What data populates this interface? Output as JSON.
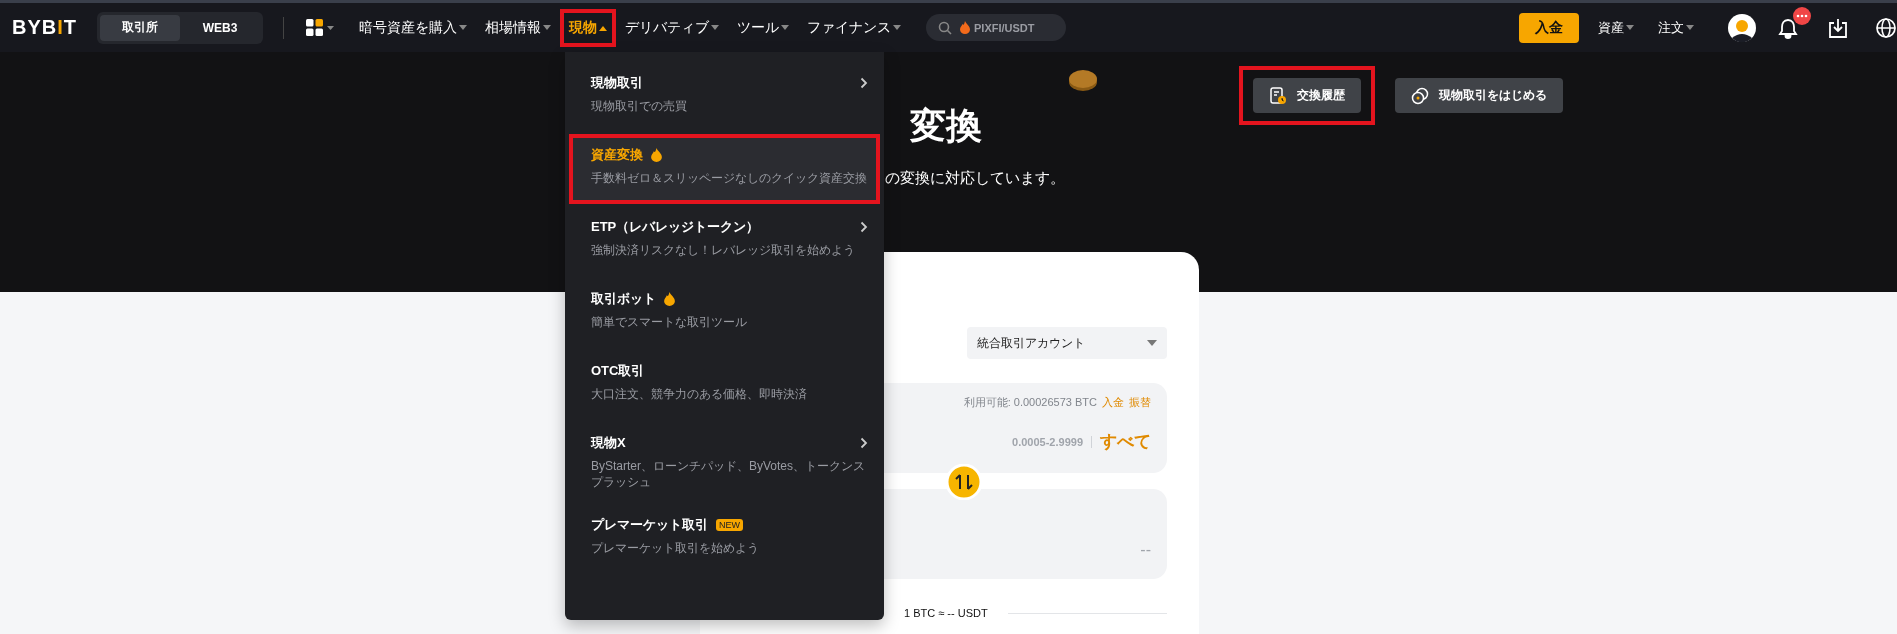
{
  "header": {
    "logo": "BYBIT",
    "segments": [
      {
        "label": "取引所",
        "selected": true
      },
      {
        "label": "WEB3",
        "selected": false
      }
    ],
    "nav": [
      {
        "label": "暗号資産を購入",
        "selected": false,
        "annotated": false
      },
      {
        "label": "相場情報",
        "selected": false,
        "annotated": false
      },
      {
        "label": "現物",
        "selected": true,
        "annotated": true
      },
      {
        "label": "デリバティブ",
        "selected": false,
        "annotated": false
      },
      {
        "label": "ツール",
        "selected": false,
        "annotated": false
      },
      {
        "label": "ファイナンス",
        "selected": false,
        "annotated": false
      }
    ],
    "search": {
      "value": "PIXFI/USDT"
    },
    "deposit_button": "入金",
    "right_menus": [
      "資産",
      "注文"
    ]
  },
  "dropdown": {
    "items": [
      {
        "title": "現物取引",
        "description": "現物取引での売買",
        "chevron": true,
        "hot": false,
        "selected": false,
        "annotated": false
      },
      {
        "title": "資産変換",
        "description": "手数料ゼロ＆スリッページなしのクイック資産交換",
        "chevron": false,
        "hot": true,
        "selected": true,
        "annotated": true
      },
      {
        "title": "ETP（レバレッジトークン）",
        "description": "強制決済リスクなし！レバレッジ取引を始めよう",
        "chevron": true,
        "hot": false,
        "selected": false,
        "annotated": false
      },
      {
        "title": "取引ボット",
        "description": "簡単でスマートな取引ツール",
        "chevron": false,
        "hot": true,
        "selected": false,
        "annotated": false
      },
      {
        "title": "OTC取引",
        "description": "大口注文、競争力のある価格、即時決済",
        "chevron": false,
        "hot": false,
        "selected": false,
        "annotated": false
      },
      {
        "title": "現物X",
        "description": "ByStarter、ローンチパッド、ByVotes、トークンスプラッシュ",
        "chevron": true,
        "hot": false,
        "selected": false,
        "annotated": false
      },
      {
        "title": "プレマーケット取引",
        "description": "プレマーケット取引を始めよう",
        "chevron": false,
        "hot": false,
        "badge": "NEW",
        "selected": false,
        "annotated": false
      }
    ]
  },
  "hero": {
    "title": "変換",
    "subtitle": "の変換に対応しています。",
    "buttons": [
      {
        "label": "交換履歴",
        "kind": "history",
        "annotated": true
      },
      {
        "label": "現物取引をはじめる",
        "kind": "spot",
        "annotated": false
      }
    ]
  },
  "converter": {
    "account": "統合取引アカウント",
    "from": {
      "available_label": "利用可能: 0.00026573 BTC",
      "deposit_link": "入金",
      "transfer_link": "振替",
      "range": "0.0005-2.9999",
      "all_button": "すべて"
    },
    "to": {
      "amount": "--"
    },
    "rate": "1 BTC ≈ -- USDT"
  }
}
